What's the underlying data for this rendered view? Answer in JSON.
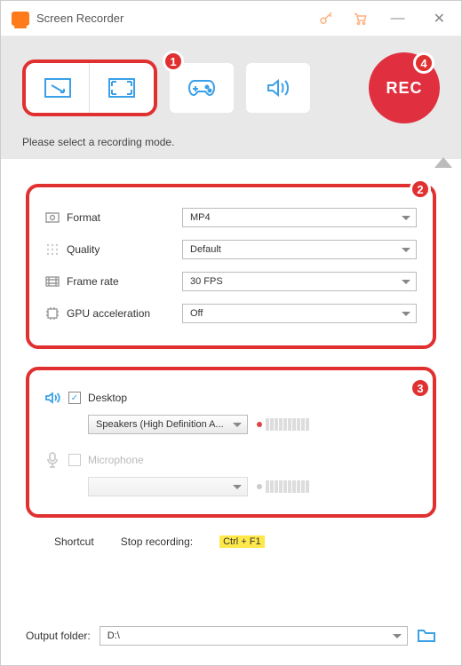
{
  "window": {
    "title": "Screen Recorder"
  },
  "toolbar": {
    "rec_label": "REC",
    "hint": "Please select a recording mode."
  },
  "settings": {
    "format": {
      "label": "Format",
      "value": "MP4"
    },
    "quality": {
      "label": "Quality",
      "value": "Default"
    },
    "framerate": {
      "label": "Frame rate",
      "value": "30 FPS"
    },
    "gpu": {
      "label": "GPU acceleration",
      "value": "Off"
    }
  },
  "audio": {
    "desktop": {
      "label": "Desktop",
      "checked": true,
      "device": "Speakers (High Definition A..."
    },
    "microphone": {
      "label": "Microphone",
      "checked": false,
      "device": ""
    }
  },
  "shortcut": {
    "label": "Shortcut",
    "stop_label": "Stop recording:",
    "stop_key": "Ctrl + F1"
  },
  "output": {
    "label": "Output folder:",
    "path": "D:\\"
  },
  "annotations": {
    "b1": "1",
    "b2": "2",
    "b3": "3",
    "b4": "4"
  }
}
